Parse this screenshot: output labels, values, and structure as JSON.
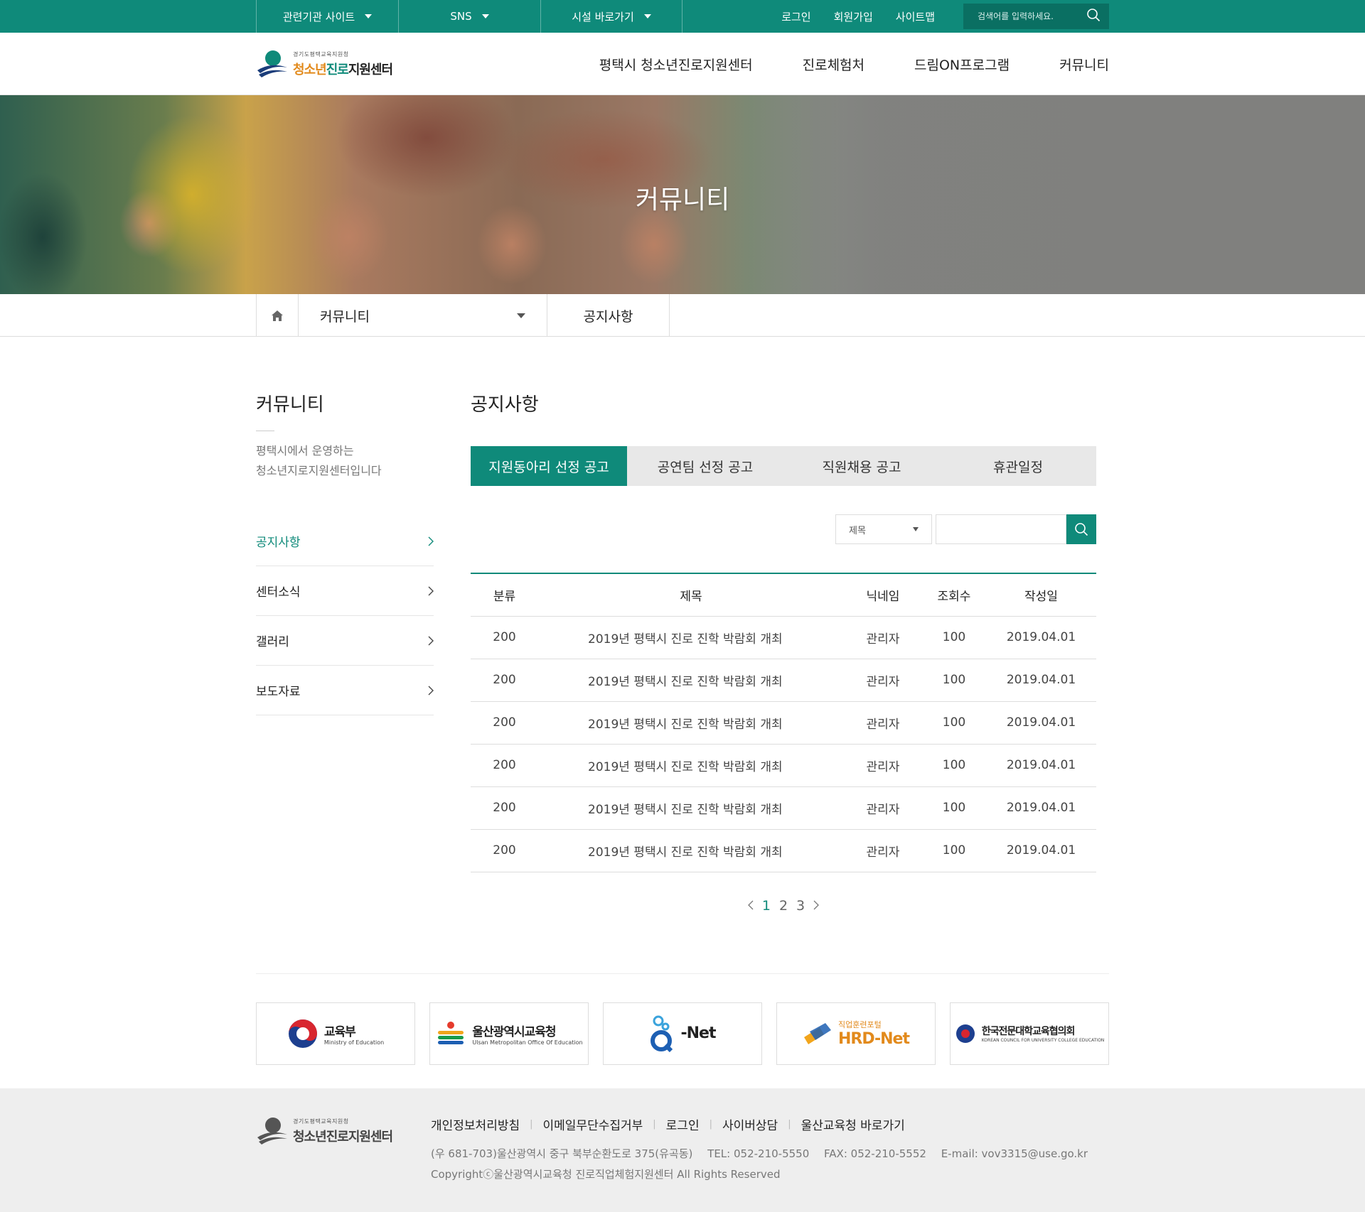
{
  "topbar": {
    "dropdowns": [
      "관련기관 사이트",
      "SNS",
      "시설 바로가기"
    ],
    "links": [
      "로그인",
      "회원가입",
      "사이트맵"
    ],
    "search_placeholder": "검색어를 입력하세요."
  },
  "header": {
    "logo_sub": "경기도평택교육지원청",
    "logo_main_1": "청소년",
    "logo_main_2": "진로",
    "logo_main_3": "지원센터",
    "nav": [
      "평택시 청소년진로지원센터",
      "진로체험처",
      "드림ON프로그램",
      "커뮤니티"
    ]
  },
  "hero": {
    "title": "커뮤니티"
  },
  "location": {
    "depth1": "커뮤니티",
    "depth2": "공지사항"
  },
  "sidebar": {
    "title": "커뮤니티",
    "desc_line1": "평택시에서 운영하는",
    "desc_line2": "청소년지로지원센터입니다",
    "items": [
      {
        "label": "공지사항",
        "active": true
      },
      {
        "label": "센터소식",
        "active": false
      },
      {
        "label": "갤러리",
        "active": false
      },
      {
        "label": "보도자료",
        "active": false
      }
    ]
  },
  "main": {
    "title": "공지사항",
    "tabs": [
      "지원동아리 선정 공고",
      "공연팀 선정 공고",
      "직원채용 공고",
      "휴관일정"
    ],
    "active_tab": 0,
    "search_select": "제목",
    "search_value": ""
  },
  "table": {
    "headers": [
      "분류",
      "제목",
      "닉네임",
      "조회수",
      "작성일"
    ],
    "rows": [
      [
        "200",
        "2019년 평택시 진로 진학 박람회 개최",
        "관리자",
        "100",
        "2019.04.01"
      ],
      [
        "200",
        "2019년 평택시 진로 진학 박람회 개최",
        "관리자",
        "100",
        "2019.04.01"
      ],
      [
        "200",
        "2019년 평택시 진로 진학 박람회 개최",
        "관리자",
        "100",
        "2019.04.01"
      ],
      [
        "200",
        "2019년 평택시 진로 진학 박람회 개최",
        "관리자",
        "100",
        "2019.04.01"
      ],
      [
        "200",
        "2019년 평택시 진로 진학 박람회 개최",
        "관리자",
        "100",
        "2019.04.01"
      ],
      [
        "200",
        "2019년 평택시 진로 진학 박람회 개최",
        "관리자",
        "100",
        "2019.04.01"
      ]
    ]
  },
  "pagination": {
    "pages": [
      "1",
      "2",
      "3"
    ],
    "current": "1"
  },
  "partners": [
    {
      "name": "교육부",
      "sub": "Ministry of Education"
    },
    {
      "name": "울산광역시교육청",
      "sub": "Ulsan Metropolitan Office Of Education"
    },
    {
      "name": "-Net",
      "sub": "Q"
    },
    {
      "name": "HRD-Net",
      "sub": "직업훈련포털"
    },
    {
      "name": "한국전문대학교육협의회",
      "sub": "KOREAN COUNCIL FOR UNIVERSITY COLLEGE EDUCATION"
    }
  ],
  "footer": {
    "links": [
      "개인정보처리방침",
      "이메일무단수집거부",
      "로그인",
      "사이버상담",
      "울산교육청 바로가기"
    ],
    "address": "(우 681-703)울산광역시 중구 북부순환도로 375(유곡동)",
    "tel": "TEL: 052-210-5550",
    "fax": "FAX: 052-210-5552",
    "email": "E-mail: vov3315@use.go.kr",
    "copyright": "Copyrightⓒ울산광역시교육청 진로직업체험지원센터 All Rights Reserved"
  },
  "colors": {
    "primary": "#0f8a7a",
    "footer_bg": "#eeeeee"
  }
}
